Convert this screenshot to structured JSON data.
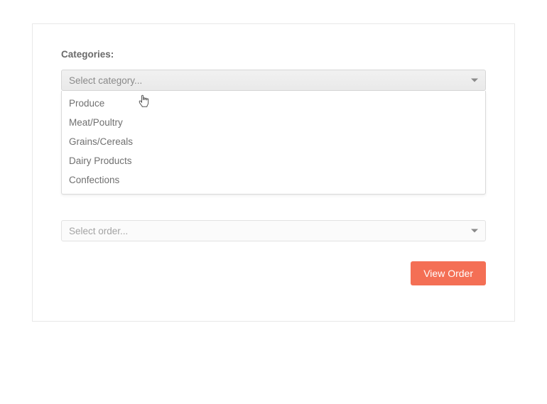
{
  "labels": {
    "categories": "Categories:"
  },
  "dropdowns": {
    "category": {
      "placeholder": "Select category...",
      "options": [
        "Produce",
        "Meat/Poultry",
        "Grains/Cereals",
        "Dairy Products",
        "Confections"
      ]
    },
    "order": {
      "placeholder": "Select order..."
    }
  },
  "buttons": {
    "view_order": "View Order"
  }
}
